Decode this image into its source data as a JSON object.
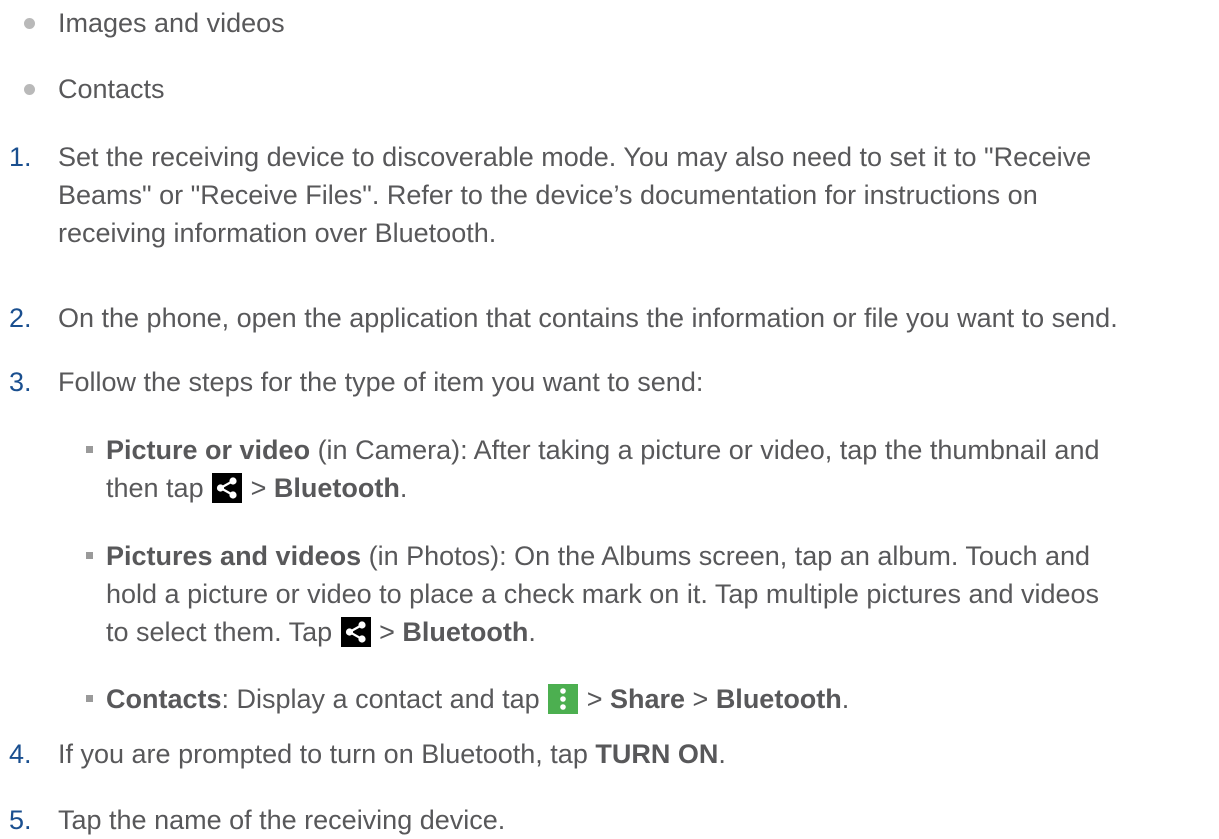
{
  "bullets": [
    {
      "text": "Images and videos"
    },
    {
      "text": "Contacts"
    }
  ],
  "steps": [
    {
      "number": "1.",
      "line1": "Set the receiving device to discoverable mode. You may also need to set it to \"Receive",
      "line2": "Beams\" or \"Receive Files\". Refer to the device’s documentation for instructions on",
      "line3": "receiving information over Bluetooth."
    },
    {
      "number": "2.",
      "text": "On the phone, open the application that contains the information or file you want to send."
    },
    {
      "number": "3.",
      "text": "Follow the steps for the type of item you want to send:"
    },
    {
      "number": "4.",
      "text_before": "If you are prompted to turn on Bluetooth, tap ",
      "bold": "TURN ON",
      "text_after": "."
    },
    {
      "number": "5.",
      "text": "Tap the name of the receiving device."
    }
  ],
  "substeps": {
    "picture_video": {
      "bold": "Picture or video",
      "line1": " (in Camera): After taking a picture or video, tap the thumbnail and",
      "line2_before": "then tap ",
      "sep": " > ",
      "bold_end": "Bluetooth",
      "end": "."
    },
    "pictures_videos": {
      "bold": "Pictures and videos",
      "line1": " (in Photos): On the Albums screen, tap an album. Touch and",
      "line2": "hold a picture or video to place a check mark on it. Tap multiple pictures and videos",
      "line3_before": "to select them. Tap ",
      "sep": " > ",
      "bold_end": "Bluetooth",
      "end": "."
    },
    "contacts": {
      "bold": "Contacts",
      "text_before": ": Display a contact and tap ",
      "sep1": " > ",
      "bold_mid": "Share",
      "sep2": " > ",
      "bold_end": "Bluetooth",
      "end": "."
    }
  },
  "icons": {
    "share": "share-icon",
    "menu": "more-vert-icon"
  },
  "colors": {
    "text": "#58585a",
    "step_number": "#1a4f8f",
    "menu_icon_bg": "#4caf50",
    "share_icon_bg": "#000000"
  }
}
